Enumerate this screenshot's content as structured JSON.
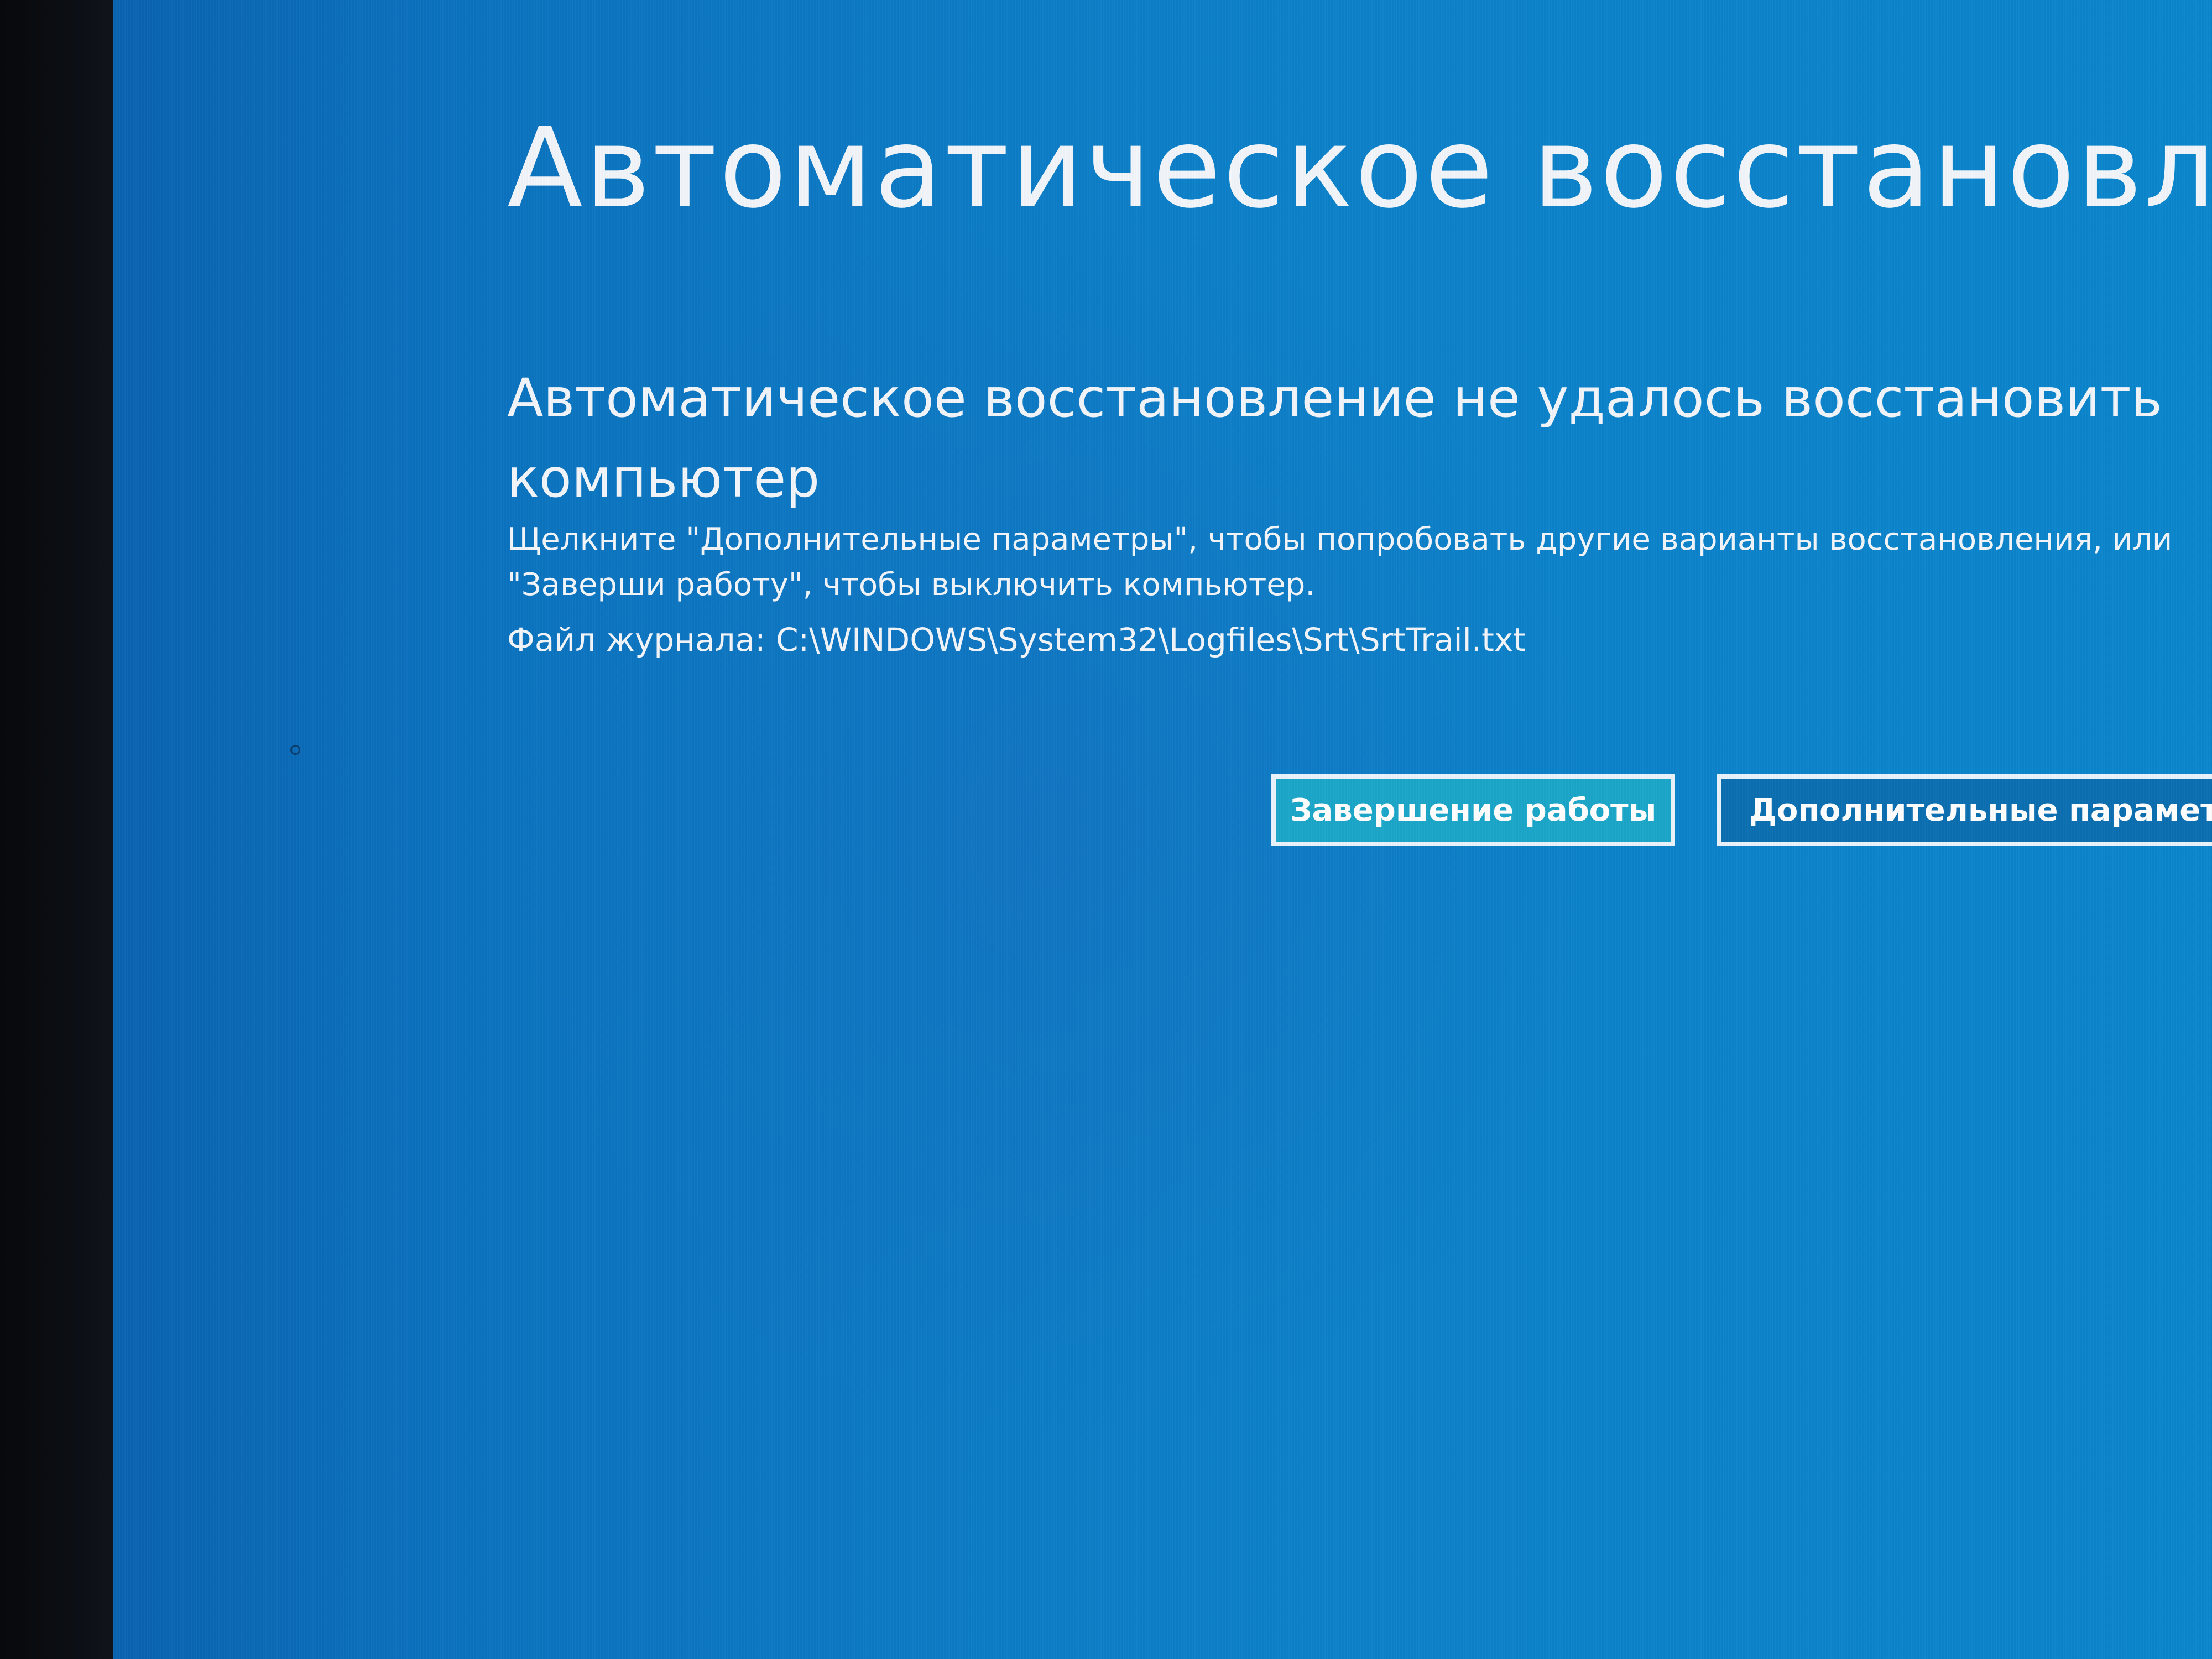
{
  "screen": {
    "title": "Автоматическое восстановлени",
    "subtitle": "Автоматическое восстановление не удалось восстановить компьютер",
    "message": "Щелкните \"Дополнительные параметры\", чтобы попробовать другие варианты восстановления, или \"Заверши работу\", чтобы выключить компьютер.",
    "logfile_label": "Файл журнала:",
    "logfile_path": "C:\\WINDOWS\\System32\\Logfiles\\Srt\\SrtTrail.txt"
  },
  "buttons": {
    "shutdown_label": "Завершение работы",
    "advanced_label": "Дополнительные параметры"
  },
  "colors": {
    "background": "#0b78c2",
    "shutdown_button": "#1aa6c8",
    "text": "#f2f6fb"
  }
}
